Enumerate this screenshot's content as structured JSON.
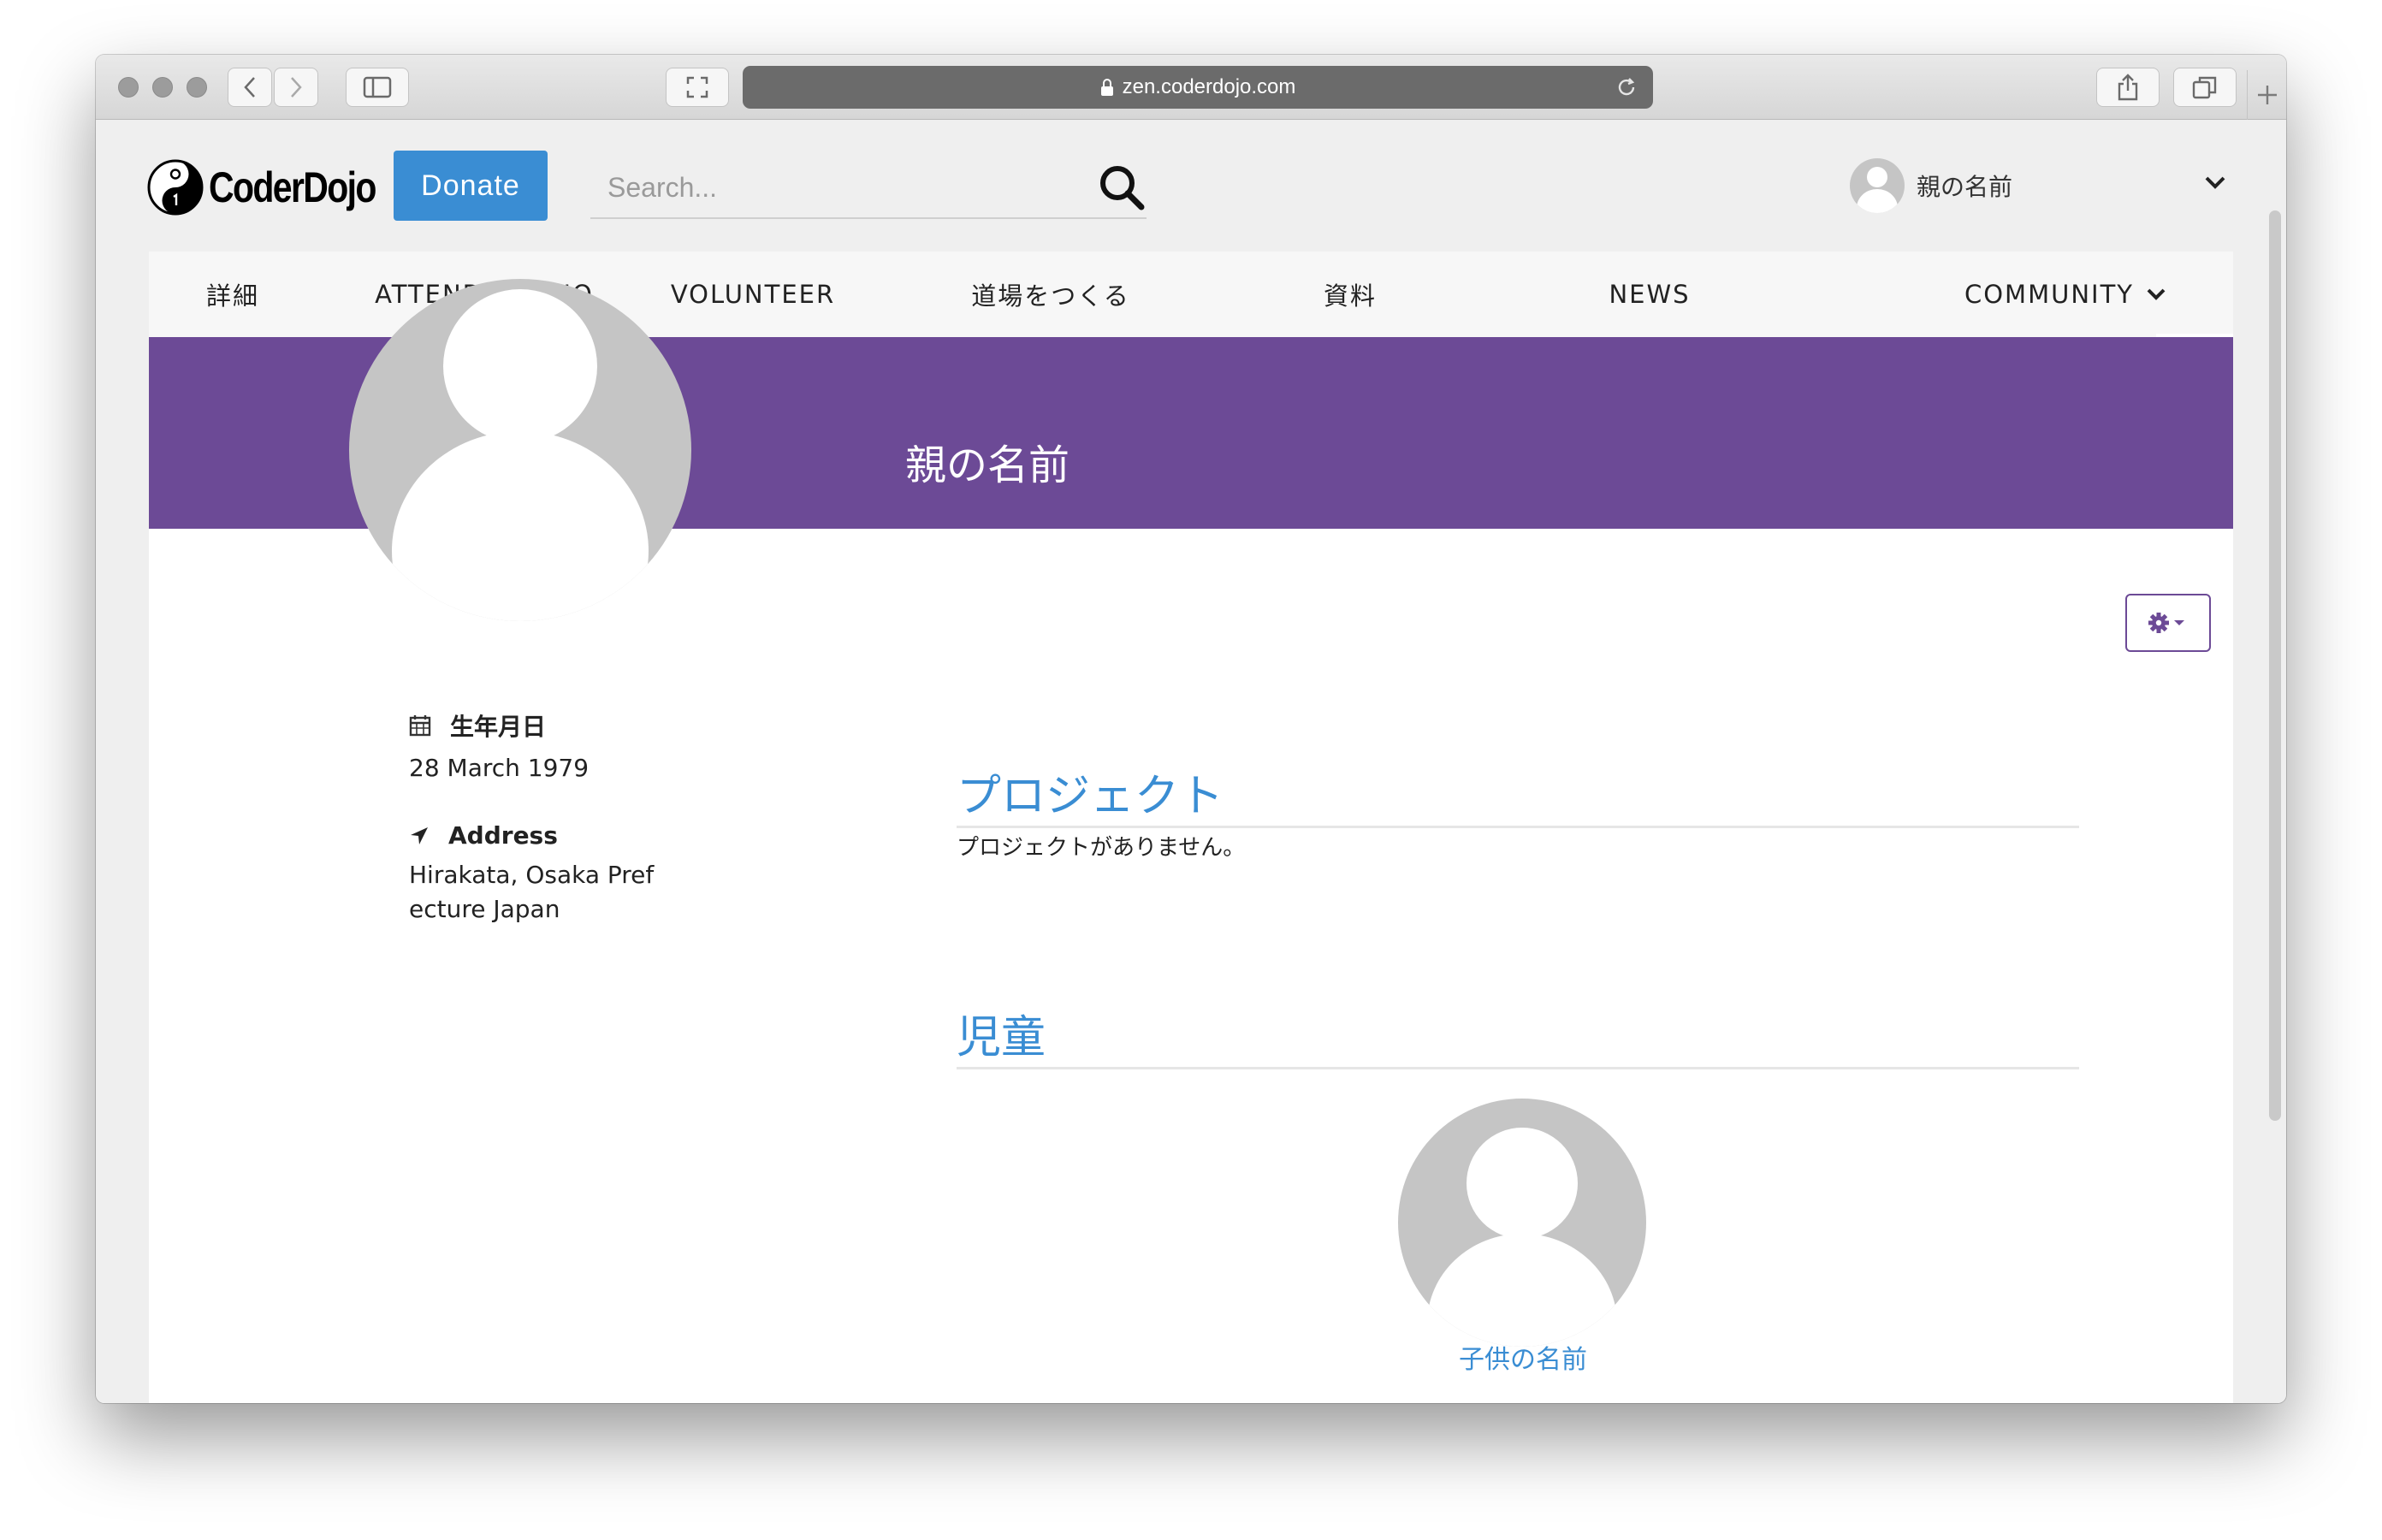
{
  "browser": {
    "url": "zen.coderdojo.com"
  },
  "header": {
    "logo_text": "CoderDojo",
    "donate_label": "Donate",
    "search_placeholder": "Search...",
    "user_name": "親の名前"
  },
  "nav": {
    "items": [
      {
        "label": "詳細"
      },
      {
        "label": "ATTEND A DOJO"
      },
      {
        "label": "VOLUNTEER"
      },
      {
        "label": "道場をつくる"
      },
      {
        "label": "資料"
      },
      {
        "label": "NEWS"
      },
      {
        "label": "COMMUNITY"
      }
    ]
  },
  "profile": {
    "name": "親の名前",
    "birthdate_label": "生年月日",
    "birthdate": "28 March 1979",
    "address_label": "Address",
    "address": "Hirakata, Osaka Prefecture  Japan"
  },
  "projects": {
    "title": "プロジェクト",
    "empty_text": "プロジェクトがありません。"
  },
  "children": {
    "title": "児童",
    "items": [
      {
        "name": "子供の名前"
      }
    ]
  },
  "colors": {
    "accent": "#3a8dd3",
    "banner": "#6c4a96",
    "avatar_placeholder": "#c5c5c5"
  }
}
